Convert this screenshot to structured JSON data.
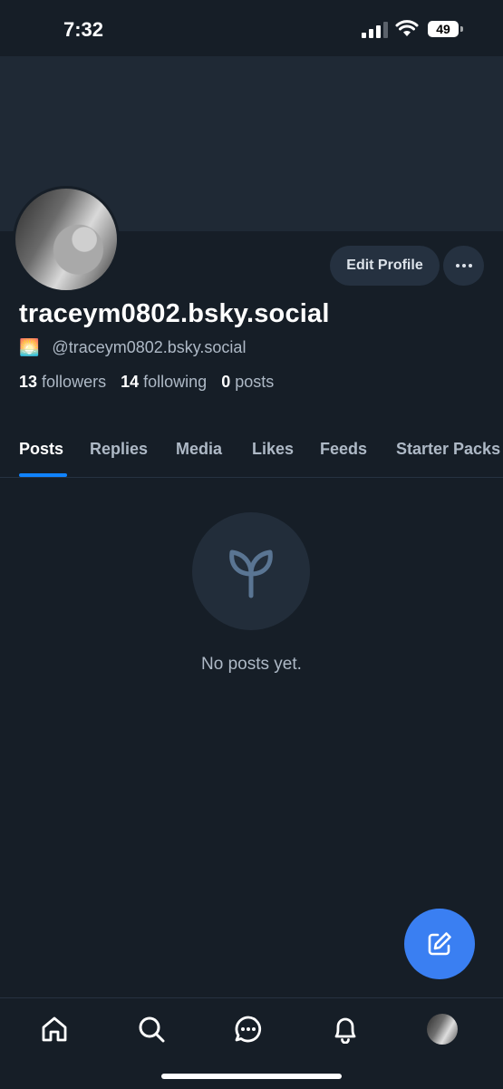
{
  "status_bar": {
    "time": "7:32",
    "battery": "49"
  },
  "profile": {
    "display_name": "traceym0802.bsky.social",
    "handle_emoji": "🌅",
    "handle": "@traceym0802.bsky.social",
    "followers_count": "13",
    "followers_label": "followers",
    "following_count": "14",
    "following_label": "following",
    "posts_count": "0",
    "posts_label": "posts",
    "edit_button_label": "Edit Profile",
    "more_button_label": "···"
  },
  "tabs": [
    {
      "label": "Posts",
      "active": true
    },
    {
      "label": "Replies"
    },
    {
      "label": "Media"
    },
    {
      "label": "Likes"
    },
    {
      "label": "Feeds"
    },
    {
      "label": "Starter Packs"
    }
  ],
  "empty_state": {
    "icon": "sprout-icon",
    "text": "No posts yet."
  },
  "fab": {
    "icon": "compose-icon"
  },
  "bottom_nav": [
    {
      "name": "home",
      "icon": "home-icon"
    },
    {
      "name": "search",
      "icon": "search-icon"
    },
    {
      "name": "chat",
      "icon": "chat-icon"
    },
    {
      "name": "notifications",
      "icon": "bell-icon"
    },
    {
      "name": "profile",
      "icon": "avatar"
    }
  ],
  "colors": {
    "background": "#161e27",
    "banner": "#1f2935",
    "accent": "#1083fe",
    "fab": "#3a7ff2"
  }
}
